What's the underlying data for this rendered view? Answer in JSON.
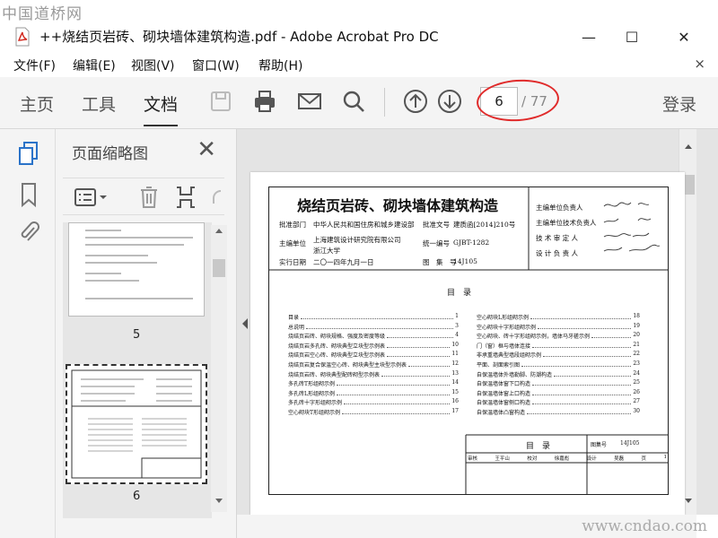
{
  "watermark_top": "中国道桥网",
  "watermark_bottom": "www.cndao.com",
  "window": {
    "title": "++烧结页岩砖、砌块墙体建筑构造.pdf - Adobe Acrobat Pro DC",
    "minimize": "—",
    "maximize": "☐",
    "close": "✕"
  },
  "menu": {
    "file": "文件(F)",
    "edit": "编辑(E)",
    "view": "视图(V)",
    "window": "窗口(W)",
    "help": "帮助(H)",
    "close": "×"
  },
  "toolbar": {
    "tabs": [
      "主页",
      "工具",
      "文档"
    ],
    "page_current": "6",
    "page_total": "/ 77",
    "login": "登录",
    "icons": [
      "save-icon",
      "print-icon",
      "mail-icon",
      "search-icon",
      "up-icon",
      "down-icon"
    ]
  },
  "panel": {
    "title": "页面缩略图",
    "close": "✕",
    "thumb_labels": [
      "5",
      "6"
    ]
  },
  "doc": {
    "title": "烧结页岩砖、砌块墙体建筑构造",
    "approval_dept_label": "批准部门",
    "approval_dept": "中华人民共和国住房和城乡建设部",
    "approval_no_label": "批准文号",
    "approval_no": "建质函[2014]210号",
    "editor_label": "主编单位",
    "editor_line1": "上海建筑设计研究院有限公司",
    "editor_line2": "浙江大学",
    "code_label": "统一编号",
    "code": "GJBT-1282",
    "date_label": "实行日期",
    "date": "二〇一四年九月一日",
    "atlas_label": "图　集　号",
    "atlas": "14J105",
    "sign_rows": [
      "主编单位负责人",
      "主编单位技术负责人",
      "技 术 审 定 人",
      "设 计 负 责 人"
    ],
    "toc_title": "目　录",
    "toc_left": [
      [
        "目录",
        "1"
      ],
      [
        "总说明",
        "3"
      ],
      [
        "烧结页岩砖、砌块规格、强度及密度等级",
        "4"
      ],
      [
        "烧结页岩多孔砖、砌块典型立块型示例表",
        "10"
      ],
      [
        "烧结页岩空心砖、砌块典型立块型示例表",
        "11"
      ],
      [
        "烧结页岩复合保温空心砖、砌块典型主块型示例表",
        "12"
      ],
      [
        "烧结页岩砖、砌块典型配砖砌型示例表",
        "13"
      ],
      [
        "多孔砖T形组砌示例",
        "14"
      ],
      [
        "多孔砖L形组砌示例",
        "15"
      ],
      [
        "多孔砖十字形组砌示例",
        "16"
      ],
      [
        "空心砌块T形组砌示例",
        "17"
      ]
    ],
    "toc_right": [
      [
        "空心砌块L形组砌示例",
        "18"
      ],
      [
        "空心砌块十字形组砌示例",
        "19"
      ],
      [
        "空心砌块、砖十字形组砌示例，墙体马牙槎示例",
        "20"
      ],
      [
        "门（窗）框与墙体连接",
        "21"
      ],
      [
        "非承重墙典型墙段组砌示例",
        "22"
      ],
      [
        "平面、剖面索引图",
        "23"
      ],
      [
        "自保温墙体外墙勒脚、防潮构造",
        "24"
      ],
      [
        "自保温墙体窗下口构造",
        "25"
      ],
      [
        "自保温墙体窗上口构造",
        "26"
      ],
      [
        "自保温墙体窗侧口构造",
        "27"
      ],
      [
        "自保温墙体凸窗构造",
        "30"
      ]
    ],
    "titleblock_label": "目　录",
    "titleblock_atlas_label": "图集号",
    "titleblock_atlas": "14J105",
    "titleblock_row": [
      "审核",
      "王平山",
      "校对",
      "徐嘉彪",
      "设计",
      "吴磊",
      "页",
      "1"
    ]
  }
}
